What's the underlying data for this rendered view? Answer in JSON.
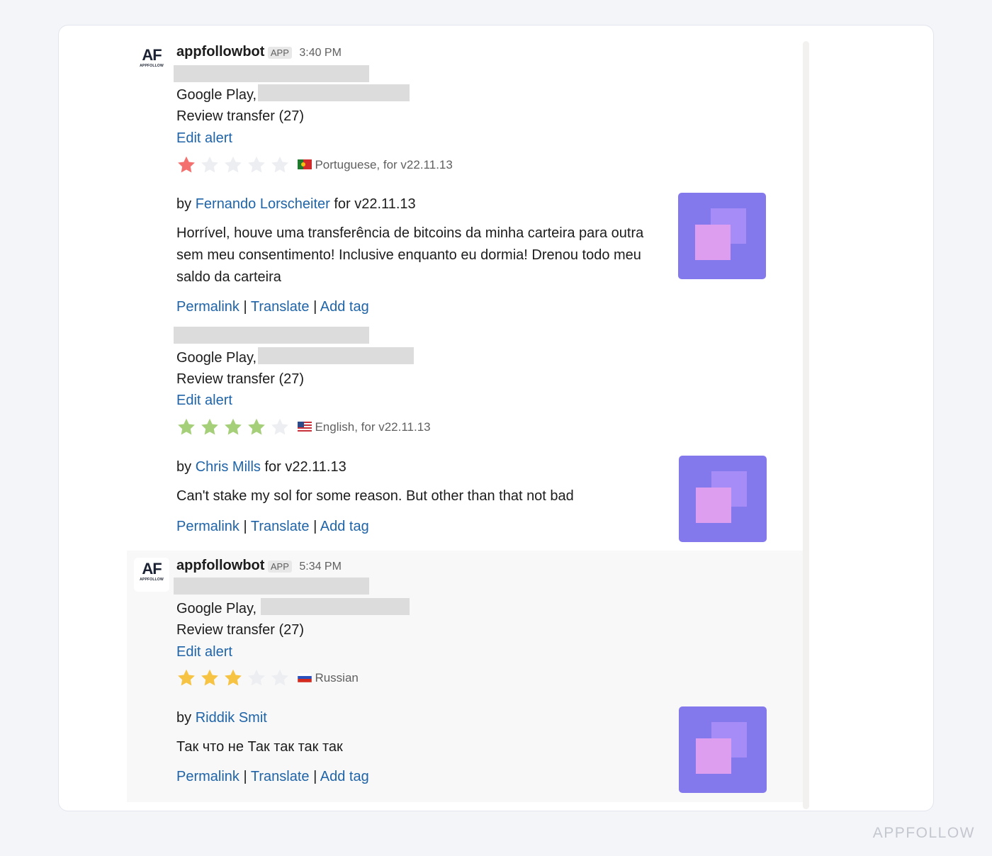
{
  "messages": [
    {
      "bot_name": "appfollowbot",
      "badge": "APP",
      "time": "3:40 PM",
      "avatar_text": "AF",
      "avatar_sub": "APPFOLLOW",
      "reviews": [
        {
          "store_label": "Google Play,",
          "alert_name": "Review transfer (27)",
          "edit_alert": "Edit alert",
          "rating": 1,
          "language": "Portuguese, for v22.11.13",
          "flag": "portugal-flag-icon",
          "by": "by",
          "author": "Fernando Lorscheiter",
          "version": "for v22.11.13",
          "text": "Horrível, houve uma transferência de bitcoins da minha carteira para outra sem meu consentimento! Inclusive enquanto eu dormia! Drenou todo meu saldo da carteira",
          "permalink": "Permalink",
          "translate": "Translate",
          "add_tag": "Add tag",
          "sep": "|"
        },
        {
          "store_label": "Google Play,",
          "alert_name": "Review transfer (27)",
          "edit_alert": "Edit alert",
          "rating": 4,
          "language": "English, for v22.11.13",
          "flag": "usa-flag-icon",
          "by": "by",
          "author": "Chris Mills",
          "version": "for v22.11.13",
          "text": "Can't stake my sol for some reason. But other than that not bad",
          "permalink": "Permalink",
          "translate": "Translate",
          "add_tag": "Add tag",
          "sep": "|"
        }
      ]
    },
    {
      "bot_name": "appfollowbot",
      "badge": "APP",
      "time": "5:34 PM",
      "avatar_text": "AF",
      "avatar_sub": "APPFOLLOW",
      "reviews": [
        {
          "store_label": "Google Play,",
          "alert_name": "Review transfer (27)",
          "edit_alert": "Edit alert",
          "rating": 3,
          "language": "Russian",
          "flag": "russia-flag-icon",
          "by": "by",
          "author": "Riddik Smit",
          "version": "",
          "text": "Так что не Так так так так",
          "permalink": "Permalink",
          "translate": "Translate",
          "add_tag": "Add tag",
          "sep": "|"
        }
      ]
    }
  ],
  "colors": {
    "link": "#1f64a8",
    "star_red": "#f3706e",
    "star_green": "#a6cf7a",
    "star_yellow": "#f6c342",
    "star_empty": "#eceef2",
    "thumb_bg": "#8478ed"
  },
  "watermark": "APPFOLLOW"
}
